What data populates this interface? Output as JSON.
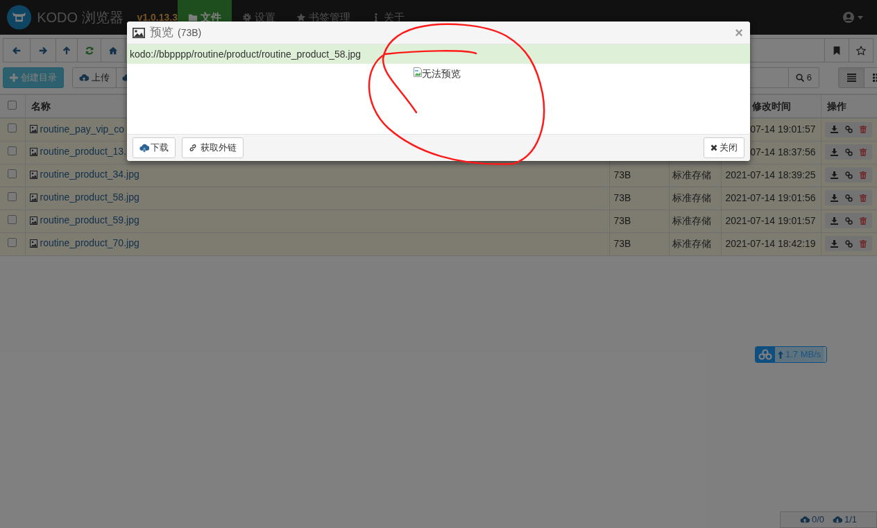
{
  "app": {
    "logo_text": "KODO 浏览器",
    "version": "v1.0.13.3"
  },
  "nav_tabs": [
    {
      "label": "文件",
      "selected": true,
      "kind": "folder"
    },
    {
      "label": "设置",
      "selected": false,
      "kind": "gear"
    },
    {
      "label": "书签管理",
      "selected": false,
      "kind": "star"
    },
    {
      "label": "关于",
      "selected": false,
      "kind": "info"
    }
  ],
  "actions": [
    {
      "label": "创建目录",
      "kind": "primary"
    },
    {
      "label": "上传",
      "kind": "default"
    }
  ],
  "search": {
    "count": "6"
  },
  "view_modes": [
    {
      "kind": "list",
      "selected": true
    },
    {
      "kind": "grid",
      "selected": false
    }
  ],
  "table": {
    "header_checked": false,
    "columns": [
      {
        "kind": "name",
        "label": "名称"
      },
      {
        "kind": "time",
        "label": "修改时间"
      },
      {
        "kind": "ops",
        "label": "操作"
      }
    ],
    "rows": [
      {
        "checked": false,
        "name": "routine_pay_vip_co",
        "time": "07-14 19:01:57"
      },
      {
        "checked": false,
        "name": "routine_product_13.",
        "time": "07-14 18:37:56"
      },
      {
        "checked": false,
        "name": "routine_product_34.jpg",
        "size": "73B",
        "storage": "标准存储",
        "time": "2021-07-14 18:39:25"
      },
      {
        "checked": false,
        "name": "routine_product_58.jpg",
        "size": "73B",
        "storage": "标准存储",
        "time": "2021-07-14 19:01:56"
      },
      {
        "checked": false,
        "name": "routine_product_59.jpg",
        "size": "73B",
        "storage": "标准存储",
        "time": "2021-07-14 19:01:57"
      },
      {
        "checked": false,
        "name": "routine_product_70.jpg",
        "size": "73B",
        "storage": "标准存储",
        "time": "2021-07-14 18:42:19"
      }
    ]
  },
  "modal": {
    "title": "预览",
    "size": "(73B)",
    "close_icon": "×",
    "path": "kodo://bbpppp/routine/product/routine_product_58.jpg",
    "image_alt": "无法预览",
    "buttons": [
      {
        "label": "下载",
        "kind": "download"
      },
      {
        "label": "获取外链",
        "kind": "link"
      }
    ],
    "close_label": "关闭"
  },
  "speed": {
    "text": "1.7 MB/s"
  },
  "transfers": {
    "upload": "0/0",
    "download": "1/1"
  }
}
